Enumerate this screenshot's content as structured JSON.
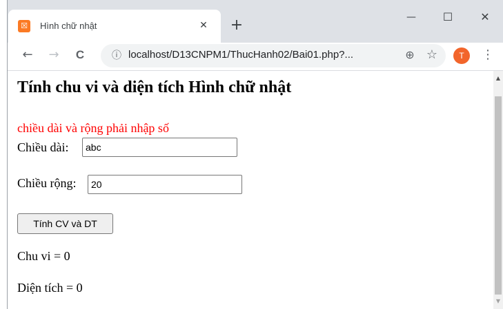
{
  "browser": {
    "tab_title": "Hình chữ nhật",
    "favicon_glyph": "☒",
    "tab_close_glyph": "✕",
    "new_tab_glyph": "+",
    "window_controls": {
      "minimize": "—",
      "maximize": "☐",
      "close": "✕"
    },
    "nav": {
      "back": "←",
      "forward": "→",
      "reload": "C"
    },
    "info_glyph": "ⓘ",
    "url": "localhost/D13CNPM1/ThucHanh02/Bai01.php?...",
    "zoom_glyph": "⊕",
    "bookmark_glyph": "☆",
    "avatar_initial": "T",
    "menu_glyph": "⋮"
  },
  "page": {
    "heading": "Tính chu vi và diện tích Hình chữ nhật",
    "error_message": "chiều dài và rộng phải nhập số",
    "length_label": "Chiều dài:",
    "length_value": "abc",
    "width_label": "Chiều rộng:",
    "width_value": "20",
    "submit_label": "Tính CV và DT",
    "perimeter_text": "Chu vi = 0",
    "area_text": "Diện tích = 0"
  },
  "colors": {
    "error": "#ff0000",
    "favicon": "#fb7a24",
    "avatar": "#f2652b",
    "tabstrip": "#dee1e6"
  },
  "icons": {
    "favicon": "xampp-icon",
    "info": "info-icon",
    "zoom": "zoom-icon",
    "bookmark": "star-icon",
    "menu": "kebab-menu-icon"
  }
}
